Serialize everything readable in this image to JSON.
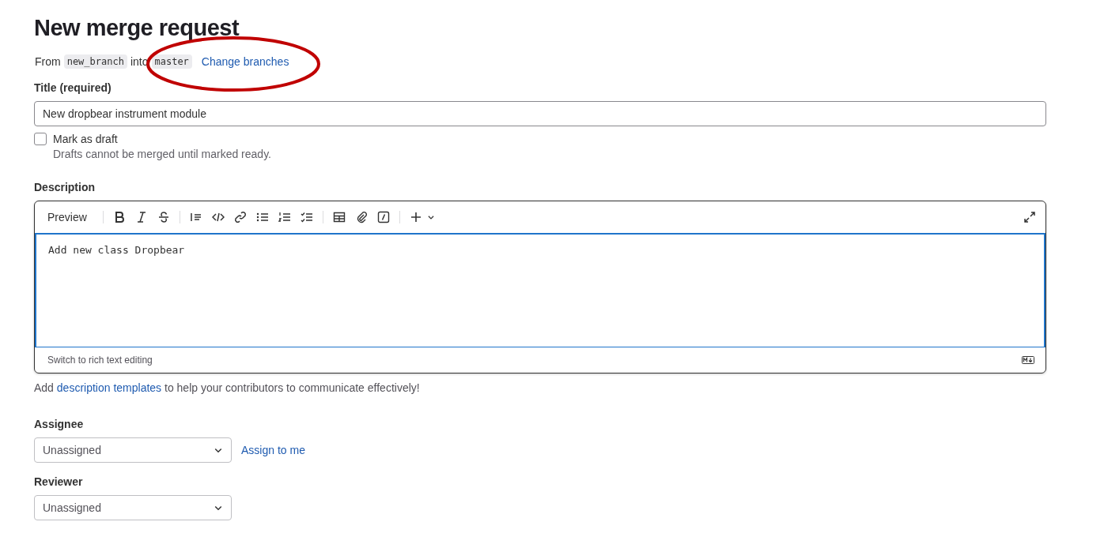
{
  "page_title": "New merge request",
  "branches": {
    "from_label": "From",
    "source": "new_branch",
    "into_label": "into",
    "target": "master",
    "change_link": "Change branches"
  },
  "annotations": [
    {
      "kind": "ellipse",
      "color": "#c00000"
    }
  ],
  "title_field": {
    "label": "Title (required)",
    "value": "New dropbear instrument module"
  },
  "draft": {
    "label": "Mark as draft",
    "checked": false,
    "help": "Drafts cannot be merged until marked ready."
  },
  "description": {
    "label": "Description",
    "preview_tab": "Preview",
    "toolbar": [
      {
        "kind": "bold"
      },
      {
        "kind": "italic"
      },
      {
        "kind": "strike"
      },
      {
        "kind": "sep"
      },
      {
        "kind": "quote"
      },
      {
        "kind": "code"
      },
      {
        "kind": "link"
      },
      {
        "kind": "bullets"
      },
      {
        "kind": "numbers"
      },
      {
        "kind": "tasks"
      },
      {
        "kind": "sep"
      },
      {
        "kind": "table"
      },
      {
        "kind": "attach"
      },
      {
        "kind": "slash"
      },
      {
        "kind": "sep"
      },
      {
        "kind": "plus"
      }
    ],
    "value": "Add new class Dropbear",
    "switch_link": "Switch to rich text editing",
    "hint_parts": [
      "Add ",
      "description templates",
      " to help your contributors to communicate effectively!"
    ]
  },
  "assignee": {
    "label": "Assignee",
    "value": "Unassigned",
    "assign_link": "Assign to me"
  },
  "reviewer": {
    "label": "Reviewer",
    "value": "Unassigned"
  }
}
